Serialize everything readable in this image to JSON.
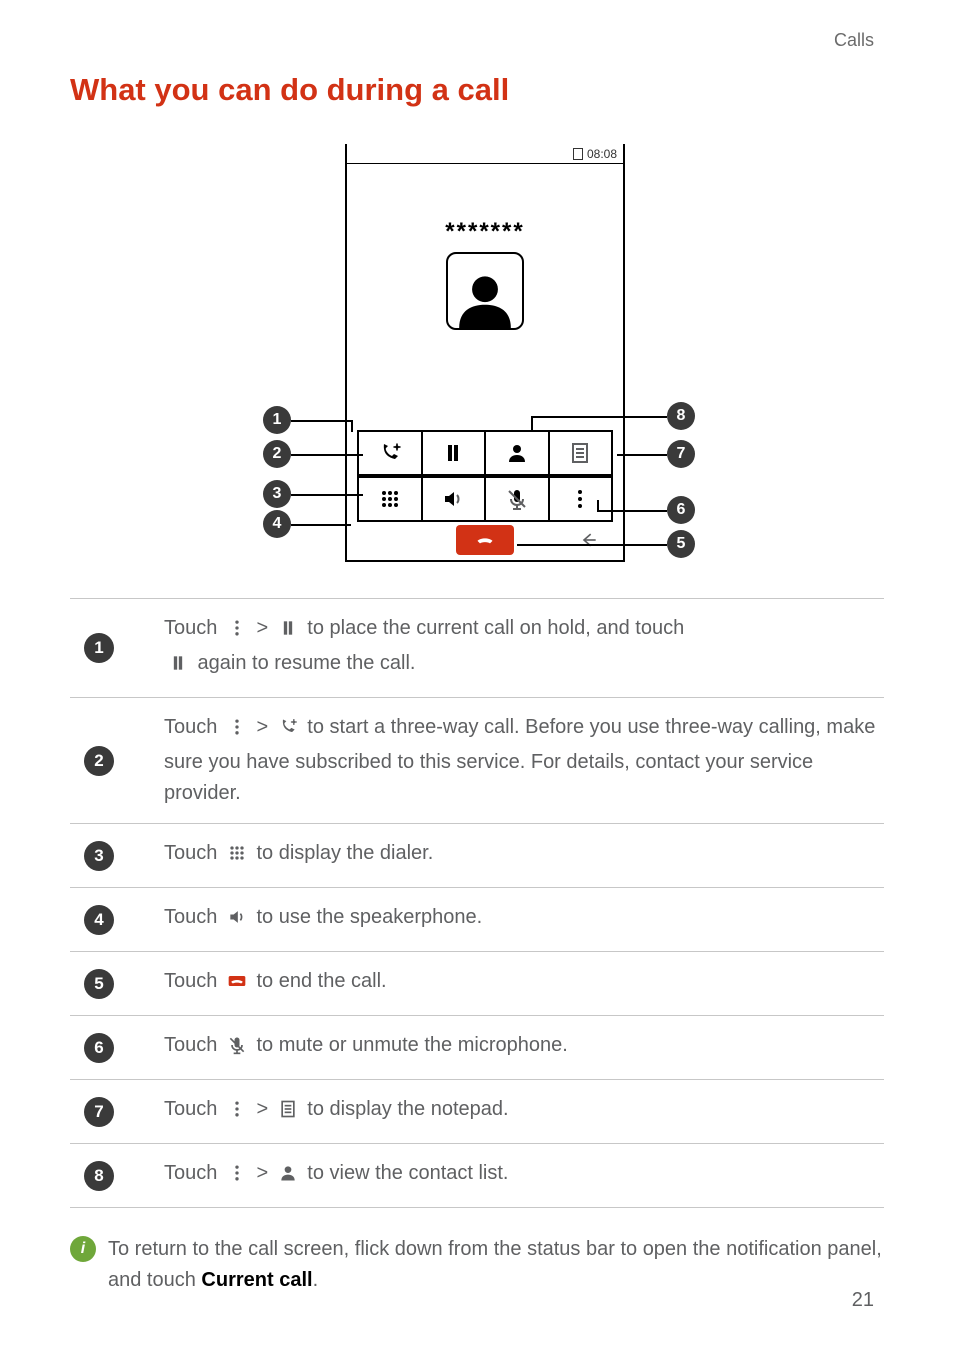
{
  "header": {
    "section": "Calls"
  },
  "title": "What you can do during a call",
  "phone": {
    "time": "08:08",
    "caller_mask": "*******"
  },
  "callouts": [
    "1",
    "2",
    "3",
    "4",
    "5",
    "6",
    "7",
    "8"
  ],
  "rows": {
    "r1": {
      "num": "1",
      "t1": "Touch ",
      "t2": " > ",
      "t3": " to place the current call on hold, and touch ",
      "t4": " again to resume the call."
    },
    "r2": {
      "num": "2",
      "t1": "Touch ",
      "t2": " > ",
      "t3": " to start a three-way call. Before you use three-way calling, make sure you have subscribed to this service. For details, contact your service provider."
    },
    "r3": {
      "num": "3",
      "t1": "Touch ",
      "t2": " to display the dialer."
    },
    "r4": {
      "num": "4",
      "t1": "Touch ",
      "t2": " to use the speakerphone."
    },
    "r5": {
      "num": "5",
      "t1": "Touch ",
      "t2": " to end the call."
    },
    "r6": {
      "num": "6",
      "t1": "Touch ",
      "t2": " to mute or unmute the microphone."
    },
    "r7": {
      "num": "7",
      "t1": "Touch ",
      "t2": " > ",
      "t3": " to display the notepad."
    },
    "r8": {
      "num": "8",
      "t1": "Touch ",
      "t2": " > ",
      "t3": " to view the contact list."
    }
  },
  "tip": {
    "t1": "To return to the call screen, flick down from the status bar to open the notification panel, and touch ",
    "bold": "Current call",
    "t2": "."
  },
  "page_number": "21"
}
